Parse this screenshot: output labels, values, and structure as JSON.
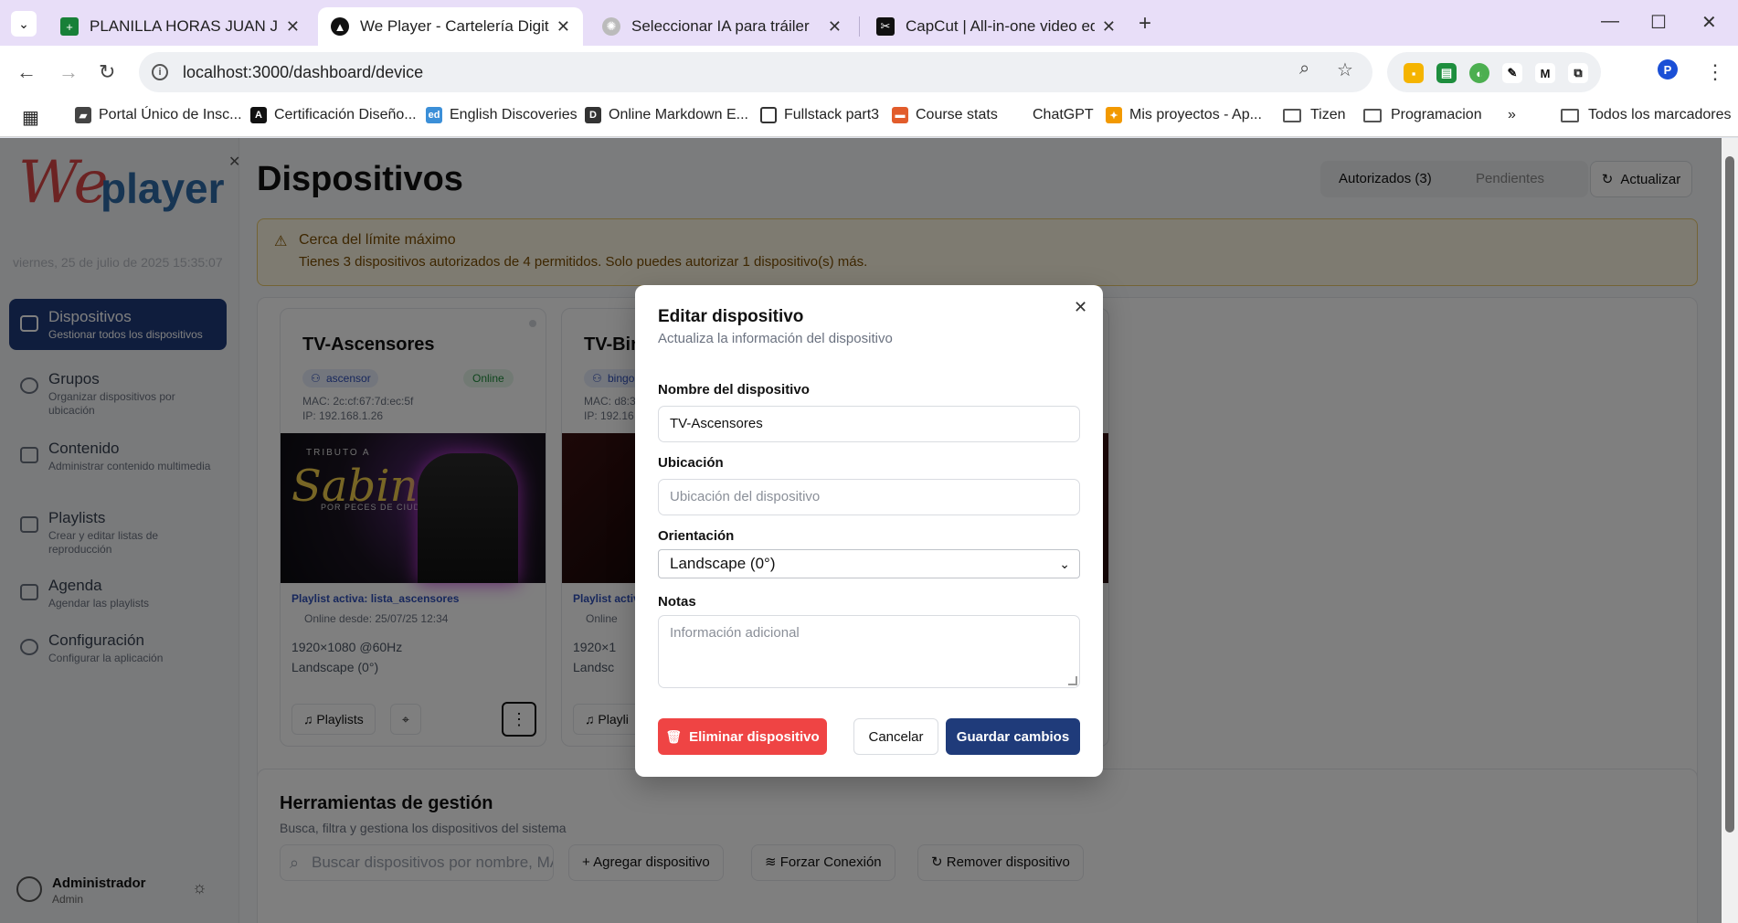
{
  "browser": {
    "tabs": [
      {
        "title": "PLANILLA HORAS JUAN JULI SEPT",
        "favicon": "sheets-icon",
        "color": "#188038"
      },
      {
        "title": "We Player - Cartelería Digital",
        "favicon": "weplayer-icon",
        "color": "#111111"
      },
      {
        "title": "Seleccionar IA para tráiler",
        "favicon": "chatgpt-icon",
        "color": "#8e8e8e"
      },
      {
        "title": "CapCut | All-in-one video editor",
        "favicon": "capcut-icon",
        "color": "#111111"
      }
    ],
    "url": "localhost:3000/dashboard/device",
    "bookmarks": [
      "Portal Único de Insc...",
      "Certificación Diseño...",
      "English Discoveries",
      "Online Markdown E...",
      "Fullstack part3",
      "Course stats",
      "ChatGPT",
      "Mis proyectos - Ap...",
      "Tizen",
      "Programacion",
      "Todos los marcadores"
    ]
  },
  "sidebar": {
    "logo_we": "We",
    "logo_player": "player",
    "date": "viernes, 25 de julio de 2025 15:35:07",
    "items": [
      {
        "title": "Dispositivos",
        "desc": "Gestionar todos los dispositivos",
        "active": true
      },
      {
        "title": "Grupos",
        "desc": "Organizar dispositivos por ubicación"
      },
      {
        "title": "Contenido",
        "desc": "Administrar contenido multimedia"
      },
      {
        "title": "Playlists",
        "desc": "Crear y editar listas de reproducción"
      },
      {
        "title": "Agenda",
        "desc": "Agendar las playlists"
      },
      {
        "title": "Configuración",
        "desc": "Configurar la aplicación"
      }
    ],
    "user": {
      "name": "Administrador",
      "role": "Admin"
    }
  },
  "main": {
    "title": "Dispositivos",
    "tab_authorized": "Autorizados (3)",
    "tab_pending": "Pendientes",
    "refresh": "Actualizar",
    "warning": {
      "title": "Cerca del límite máximo",
      "desc": "Tienes 3 dispositivos autorizados de 4 permitidos. Solo puedes autorizar 1 dispositivo(s) más."
    },
    "cards": [
      {
        "name": "TV-Ascensores",
        "group": "ascensor",
        "status": "Online",
        "mac": "MAC: 2c:cf:67:7d:ec:5f",
        "ip": "IP: 192.168.1.26",
        "thumb_tribute": "TRIBUTO A",
        "thumb_name": "Sabina",
        "thumb_band": "POR PECES DE CIUDAD",
        "playlist": "Playlist activa: lista_ascensores",
        "online_since": "Online desde: 25/07/25 12:34",
        "resolution": "1920×1080 @60Hz",
        "orientation": "Landscape (0°)",
        "playlists_btn": "Playlists"
      },
      {
        "name": "TV-Bingo",
        "group": "bingo",
        "status": "",
        "mac": "MAC: d8:3",
        "ip": "IP: 192.16",
        "playlist": "Playlist activa",
        "online_since": "Online",
        "resolution": "1920×1",
        "orientation": "Landsc",
        "playlists_btn": "Playli"
      }
    ],
    "tools": {
      "title": "Herramientas de gestión",
      "desc": "Busca, filtra y gestiona los dispositivos del sistema",
      "search_placeholder": "Buscar dispositivos por nombre, MAC...",
      "add": "Agregar dispositivo",
      "force": "Forzar Conexión",
      "remove": "Remover dispositivo"
    }
  },
  "modal": {
    "title": "Editar dispositivo",
    "desc": "Actualiza la información del dispositivo",
    "name_label": "Nombre del dispositivo",
    "name_value": "TV-Ascensores",
    "location_label": "Ubicación",
    "location_placeholder": "Ubicación del dispositivo",
    "orientation_label": "Orientación",
    "orientation_value": "Landscape (0°)",
    "notes_label": "Notas",
    "notes_placeholder": "Información adicional",
    "delete": "Eliminar dispositivo",
    "cancel": "Cancelar",
    "save": "Guardar cambios"
  },
  "colors": {
    "primary": "#1f3b7a",
    "danger": "#ef4444",
    "warning_bg": "#fdf7e3",
    "online": "#1f8a3b"
  }
}
